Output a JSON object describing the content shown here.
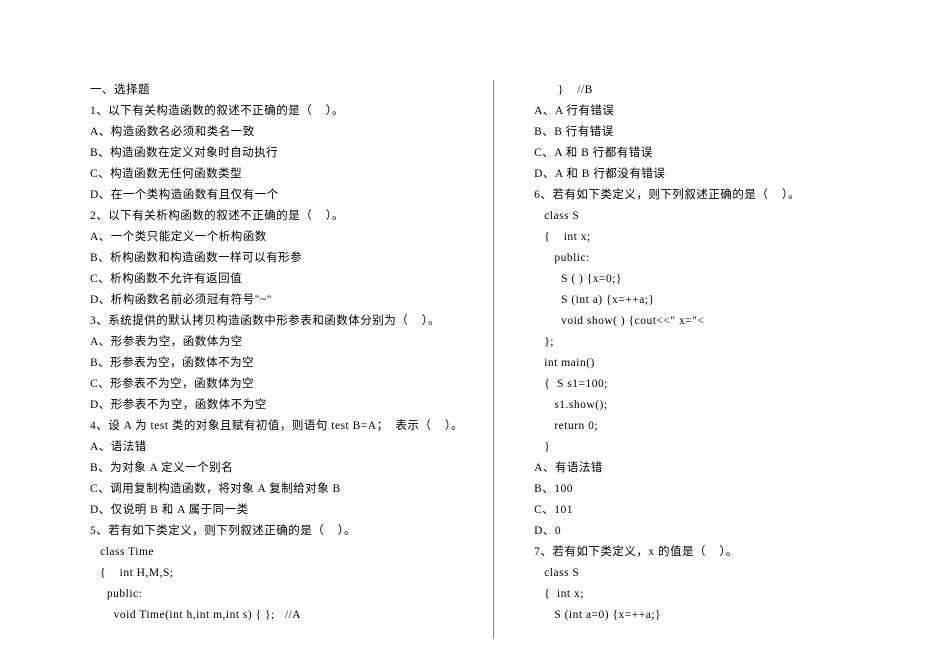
{
  "left": {
    "lines": [
      "一、选择题",
      "1、以下有关构造函数的叙述不正确的是（    ）。",
      "A、构造函数名必须和类名一致",
      "B、构造函数在定义对象时自动执行",
      "C、构造函数无任何函数类型",
      "D、在一个类构造函数有且仅有一个",
      "2、以下有关析构函数的叙述不正确的是（    ）。",
      "A、一个类只能定义一个析构函数",
      "B、析构函数和构造函数一样可以有形参",
      "C、析构函数不允许有返回值",
      "D、析构函数名前必须冠有符号\"~\"",
      "3、系统提供的默认拷贝构造函数中形参表和函数体分别为（    ）。",
      "A、形参表为空，函数体为空",
      "B、形参表为空，函数体不为空",
      "C、形参表不为空，函数体为空",
      "D、形参表不为空，函数体不为空",
      "4、设 A 为 test 类的对象且赋有初值，则语句 test B=A；  表示（    ）。",
      "A、语法错",
      "B、为对象 A 定义一个别名",
      "C、调用复制构造函数，将对象 A 复制给对象 B",
      "D、仅说明 B 和 A 属于同一类",
      "5、若有如下类定义，则下列叙述正确的是（    ）。",
      "   class Time",
      "   {    int H,M,S;",
      "     public:",
      "       void Time(int h,int m,int s) { };   //A"
    ]
  },
  "right": {
    "lines": [
      "       }    //B",
      "A、A 行有错误",
      "B、B 行有错误",
      "C、A 和 B 行都有错误",
      "D、A 和 B 行都没有错误",
      "6、若有如下类定义，则下列叙述正确的是（    ）。",
      "   class S",
      "   {    int x;",
      "      public:",
      "        S ( ) {x=0;}",
      "        S (int a) {x=++a;}",
      "        void show( ) {cout<<\" x=\"<",
      "   };",
      "   int main()",
      "   {  S s1=100;",
      "      s1.show();",
      "      return 0;",
      "   }",
      "A、有语法错",
      "B、100",
      "C、101",
      "D、0",
      "7、若有如下类定义，x 的值是（    ）。",
      "   class S",
      "   {  int x;",
      "      S (int a=0) {x=++a;}"
    ]
  }
}
